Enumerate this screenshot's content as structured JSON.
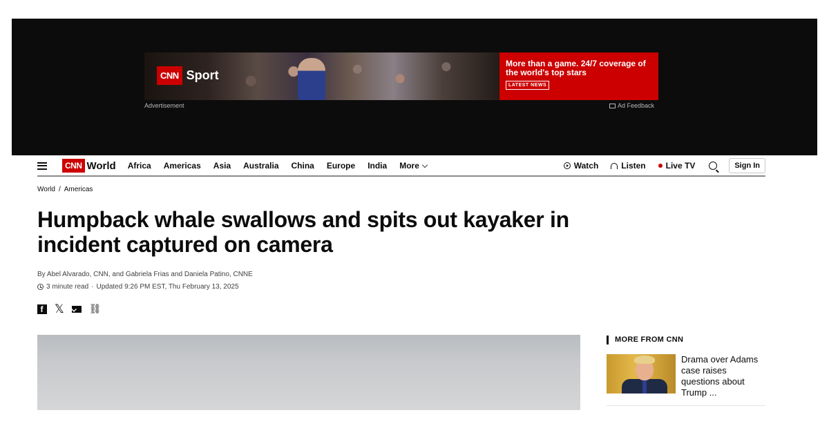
{
  "ad": {
    "brand_logo": "CNN",
    "brand_name": "Sport",
    "headline": "More than a game. 24/7 coverage of the world's top stars",
    "cta": "LATEST NEWS",
    "label": "Advertisement",
    "feedback": "Ad Feedback"
  },
  "header": {
    "logo": "CNN",
    "section": "World",
    "nav": [
      "Africa",
      "Americas",
      "Asia",
      "Australia",
      "China",
      "Europe",
      "India"
    ],
    "more": "More",
    "watch": "Watch",
    "listen": "Listen",
    "live_tv": "Live TV",
    "sign_in": "Sign In"
  },
  "breadcrumb": {
    "world": "World",
    "sep": "/",
    "americas": "Americas"
  },
  "article": {
    "headline": "Humpback whale swallows and spits out kayaker in incident captured on camera",
    "byline": "By Abel Alvarado, CNN, and Gabriela Frias and Daniela Patino, CNNE",
    "read_time": "3 minute read",
    "updated": "Updated 9:26 PM EST, Thu February 13, 2025"
  },
  "rail": {
    "title": "MORE FROM CNN",
    "card_text": "Drama over Adams case raises questions about Trump ..."
  },
  "colors": {
    "brand_red": "#cc0000",
    "text": "#0c0c0c",
    "ad_background": "#0c0c0c"
  }
}
